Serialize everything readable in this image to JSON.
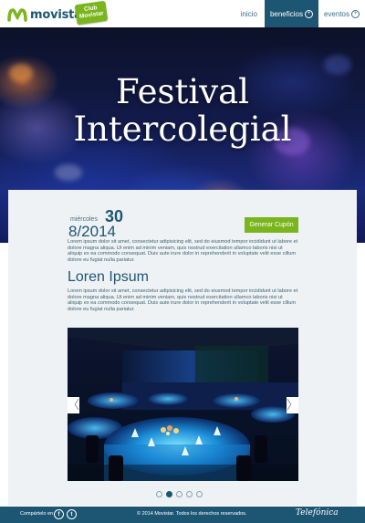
{
  "header": {
    "brand": "movistar",
    "club_badge": "Club Movistar",
    "nav": [
      {
        "label": "inicio",
        "active": false
      },
      {
        "label": "beneficios",
        "active": true
      },
      {
        "label": "eventos",
        "active": false
      }
    ]
  },
  "hero": {
    "title": "Festival Intercolegial"
  },
  "event": {
    "weekday": "miércoles",
    "day": "30",
    "month_year": "8/2014",
    "coupon_button": "Generar Cupón",
    "paragraph_1": "Lorem ipsum dolor sit amet, consectetur adipisicing elit, sed do eiusmod tempor incididunt ut labore et dolore magna aliqua. Ut enim ad minim veniam, quis nostrud exercitation ullamco laboris nisi ut aliquip ex ea commodo consequat. Duis aute irure dolor in reprehenderit in voluptate velit esse cillum dolore eu fugiat nulla pariatur.",
    "section_heading": "Loren Ipsum",
    "paragraph_2": "Lorem ipsum dolor sit amet, consectetur adipisicing elit, sed do eiusmod tempor incididunt ut labore et dolore magna aliqua. Ut enim ad minim veniam, quis nostrud exercitation ullamco laboris nisi ut aliquip ex ea commodo consequat. Duis aute irure dolor in reprehenderit in voluptate velit esse cillum dolore eu fugiat nulla pariatur."
  },
  "carousel": {
    "prev_arrow": "〈",
    "next_arrow": "〉",
    "slide_count": 5,
    "active_slide": 2
  },
  "footer": {
    "share_label": "Compártelo en",
    "social": [
      {
        "icon": "facebook-icon",
        "glyph": "f"
      },
      {
        "icon": "twitter-icon",
        "glyph": "t"
      }
    ],
    "copyright": "© 2014 Movistar. Todos los derechos reservados.",
    "partner": "Telefónica"
  },
  "colors": {
    "brand_blue": "#1d5673",
    "accent_green": "#7ab51d",
    "card_bg": "#eef2f4"
  }
}
